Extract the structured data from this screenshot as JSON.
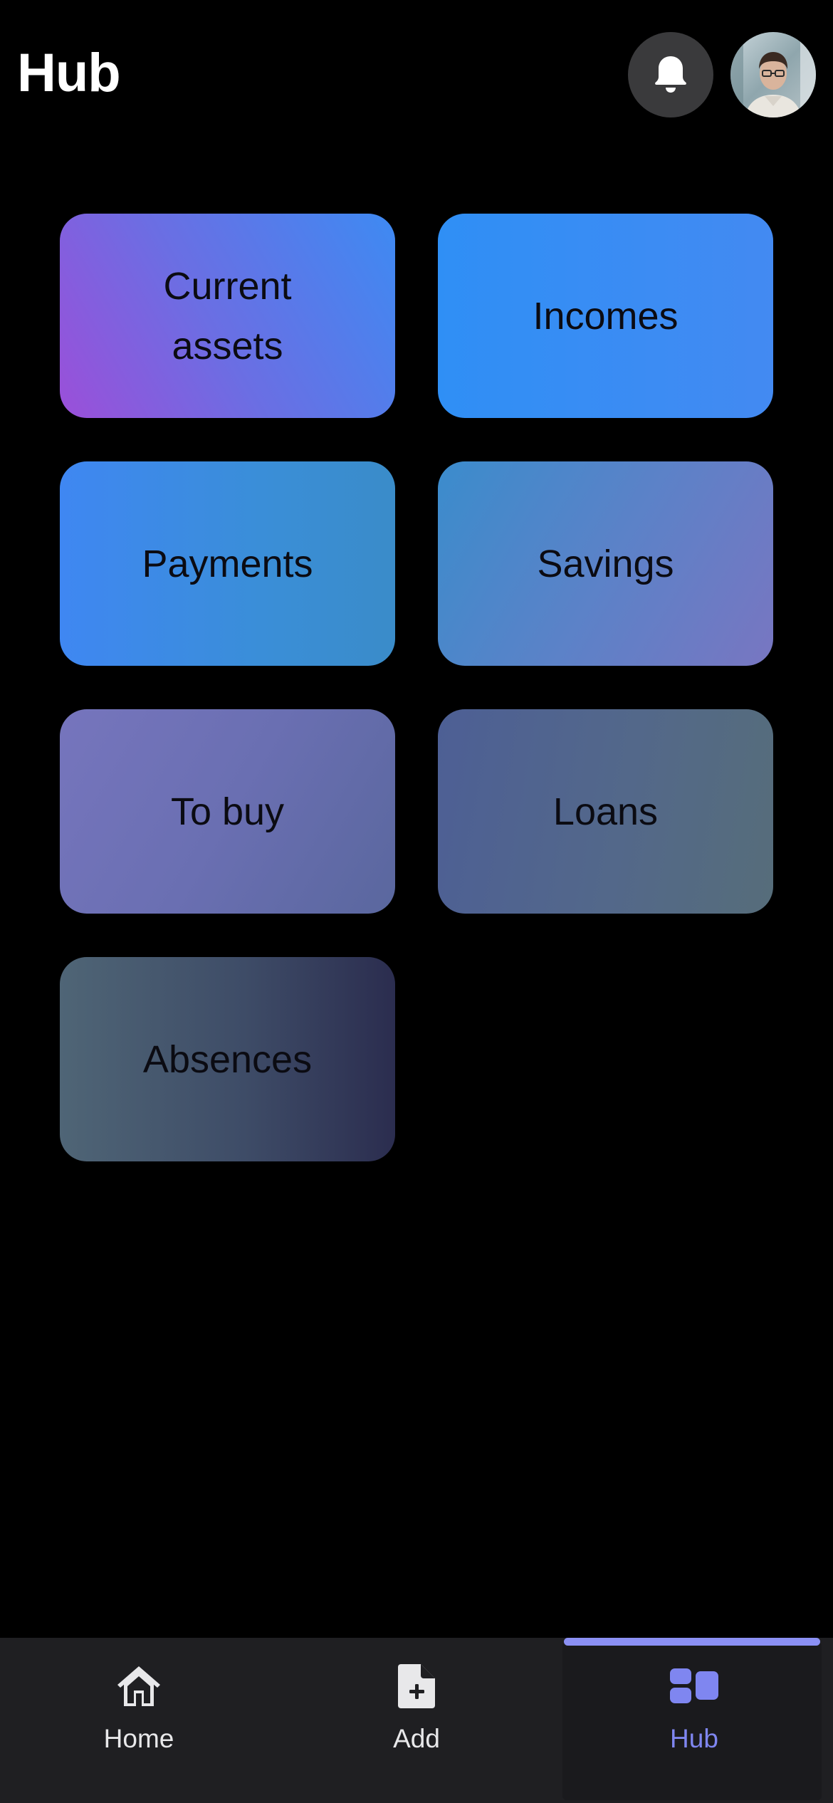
{
  "header": {
    "title": "Hub",
    "notification_icon": "bell-icon",
    "avatar_icon": "user-avatar"
  },
  "tiles": [
    {
      "label": "Current assets"
    },
    {
      "label": "Incomes"
    },
    {
      "label": "Payments"
    },
    {
      "label": "Savings"
    },
    {
      "label": "To buy"
    },
    {
      "label": "Loans"
    },
    {
      "label": "Absences"
    }
  ],
  "tab_bar": {
    "items": [
      {
        "label": "Home",
        "icon": "home-icon",
        "active": false
      },
      {
        "label": "Add",
        "icon": "add-document-icon",
        "active": false
      },
      {
        "label": "Hub",
        "icon": "dashboard-icon",
        "active": true
      }
    ]
  },
  "colors": {
    "background": "#000000",
    "tab_bar": "#1f1f22",
    "accent": "#7f86f0",
    "tile_text": "#0b0b12"
  }
}
